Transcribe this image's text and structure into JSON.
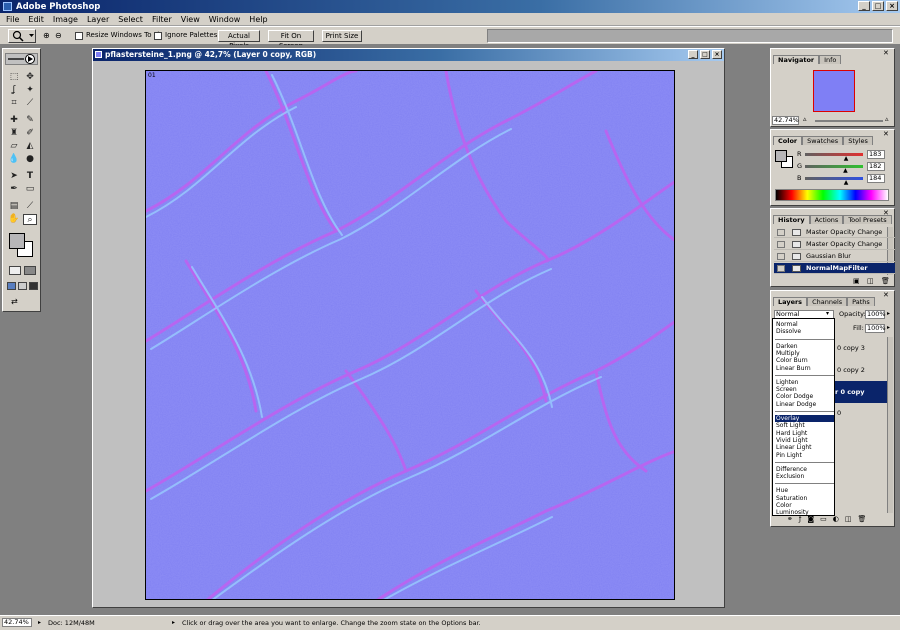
{
  "app": {
    "title": "Adobe Photoshop"
  },
  "menu": [
    "File",
    "Edit",
    "Image",
    "Layer",
    "Select",
    "Filter",
    "View",
    "Window",
    "Help"
  ],
  "options": {
    "resize_windows": "Resize Windows To Fit",
    "ignore_palettes": "Ignore Palettes",
    "actual_pixels": "Actual Pixels",
    "fit_on_screen": "Fit On Screen",
    "print_size": "Print Size"
  },
  "document": {
    "title": "pflastersteine_1.png @ 42,7% (Layer 0 copy, RGB)",
    "zoom_label": "01"
  },
  "navigator": {
    "tabs": [
      "Navigator",
      "Info"
    ],
    "zoom": "42.74%"
  },
  "color": {
    "tabs": [
      "Color",
      "Swatches",
      "Styles"
    ],
    "channels": [
      {
        "label": "R",
        "value": "183",
        "slider_fraction": 0.72
      },
      {
        "label": "G",
        "value": "182",
        "slider_fraction": 0.71
      },
      {
        "label": "B",
        "value": "184",
        "slider_fraction": 0.72
      }
    ]
  },
  "history": {
    "tabs": [
      "History",
      "Actions",
      "Tool Presets"
    ],
    "items": [
      {
        "label": "Master Opacity Change",
        "selected": false
      },
      {
        "label": "Master Opacity Change",
        "selected": false
      },
      {
        "label": "Gaussian Blur",
        "selected": false
      },
      {
        "label": "NormalMapFilter",
        "selected": true
      }
    ]
  },
  "layers": {
    "tabs": [
      "Layers",
      "Channels",
      "Paths"
    ],
    "blend_mode": "Normal",
    "opacity_label": "Opacity:",
    "opacity": "100%",
    "fill_label": "Fill:",
    "fill": "100%",
    "visible_layer_fragments": [
      "0 copy 3",
      "0 copy 2",
      "r 0 copy",
      "0"
    ],
    "blend_options": [
      [
        "Normal",
        "Dissolve"
      ],
      [
        "Darken",
        "Multiply",
        "Color Burn",
        "Linear Burn"
      ],
      [
        "Lighten",
        "Screen",
        "Color Dodge",
        "Linear Dodge"
      ],
      [
        "Overlay",
        "Soft Light",
        "Hard Light",
        "Vivid Light",
        "Linear Light",
        "Pin Light"
      ],
      [
        "Difference",
        "Exclusion"
      ],
      [
        "Hue",
        "Saturation",
        "Color",
        "Luminosity"
      ]
    ],
    "highlighted_option": "Overlay"
  },
  "status": {
    "zoom": "42.74%",
    "doc": "Doc: 12M/48M",
    "hint": "Click or drag over the area you want to enlarge. Change the zoom state on the Options bar."
  },
  "colors": {
    "titlebar": "#0a246a",
    "normal_map_base": "#7f7ff5",
    "selection": "#0a246a"
  }
}
